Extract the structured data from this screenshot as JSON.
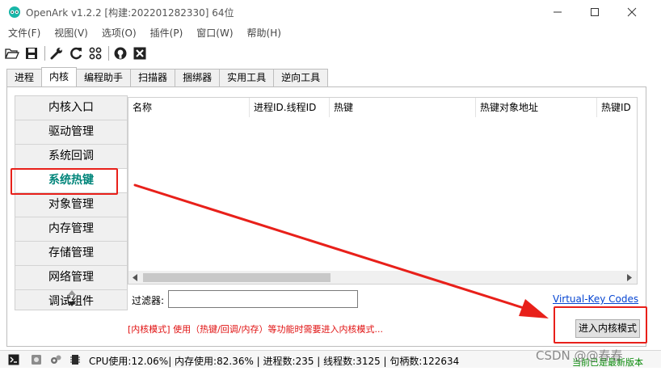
{
  "window": {
    "title": "OpenArk v1.2.2  [构建:202201282330]  64位",
    "controls": [
      "minimize-icon",
      "maximize-icon",
      "close-icon"
    ]
  },
  "menu": [
    "文件(F)",
    "视图(V)",
    "选项(O)",
    "插件(P)",
    "窗口(W)",
    "帮助(H)"
  ],
  "toolbar": [
    "folder-open-icon",
    "save-icon",
    "wrench-icon",
    "refresh-icon",
    "grid-icon",
    "globe-icon",
    "close-box-icon"
  ],
  "tabs": [
    "进程",
    "内核",
    "编程助手",
    "扫描器",
    "捆绑器",
    "实用工具",
    "逆向工具"
  ],
  "active_tab": "内核",
  "kernel_nav": {
    "items": [
      "内核入口",
      "驱动管理",
      "系统回调",
      "系统热键",
      "对象管理",
      "内存管理",
      "存储管理",
      "网络管理",
      "调试组件"
    ],
    "active": "系统热键"
  },
  "table": {
    "columns": [
      "名称",
      "进程ID.线程ID",
      "热键",
      "热键对象地址",
      "热键ID"
    ],
    "rows": []
  },
  "filter": {
    "label": "过滤器:",
    "value": ""
  },
  "links": {
    "virtual_key": "Virtual-Key Codes"
  },
  "hint": "[内核模式] 使用（热键/回调/内存）等功能时需要进入内核模式...",
  "buttons": {
    "enter_kernel": "进入内核模式"
  },
  "status": {
    "text": "CPU使用:12.06%| 内存使用:82.36% | 进程数:235 | 线程数:3125 | 句柄数:122634",
    "version": "当前已是最新版本"
  },
  "watermark": "CSDN @@春春",
  "colors": {
    "highlight": "#e8201a",
    "active_nav": "#00857a",
    "hint": "#e01010",
    "link": "#0645d2"
  }
}
